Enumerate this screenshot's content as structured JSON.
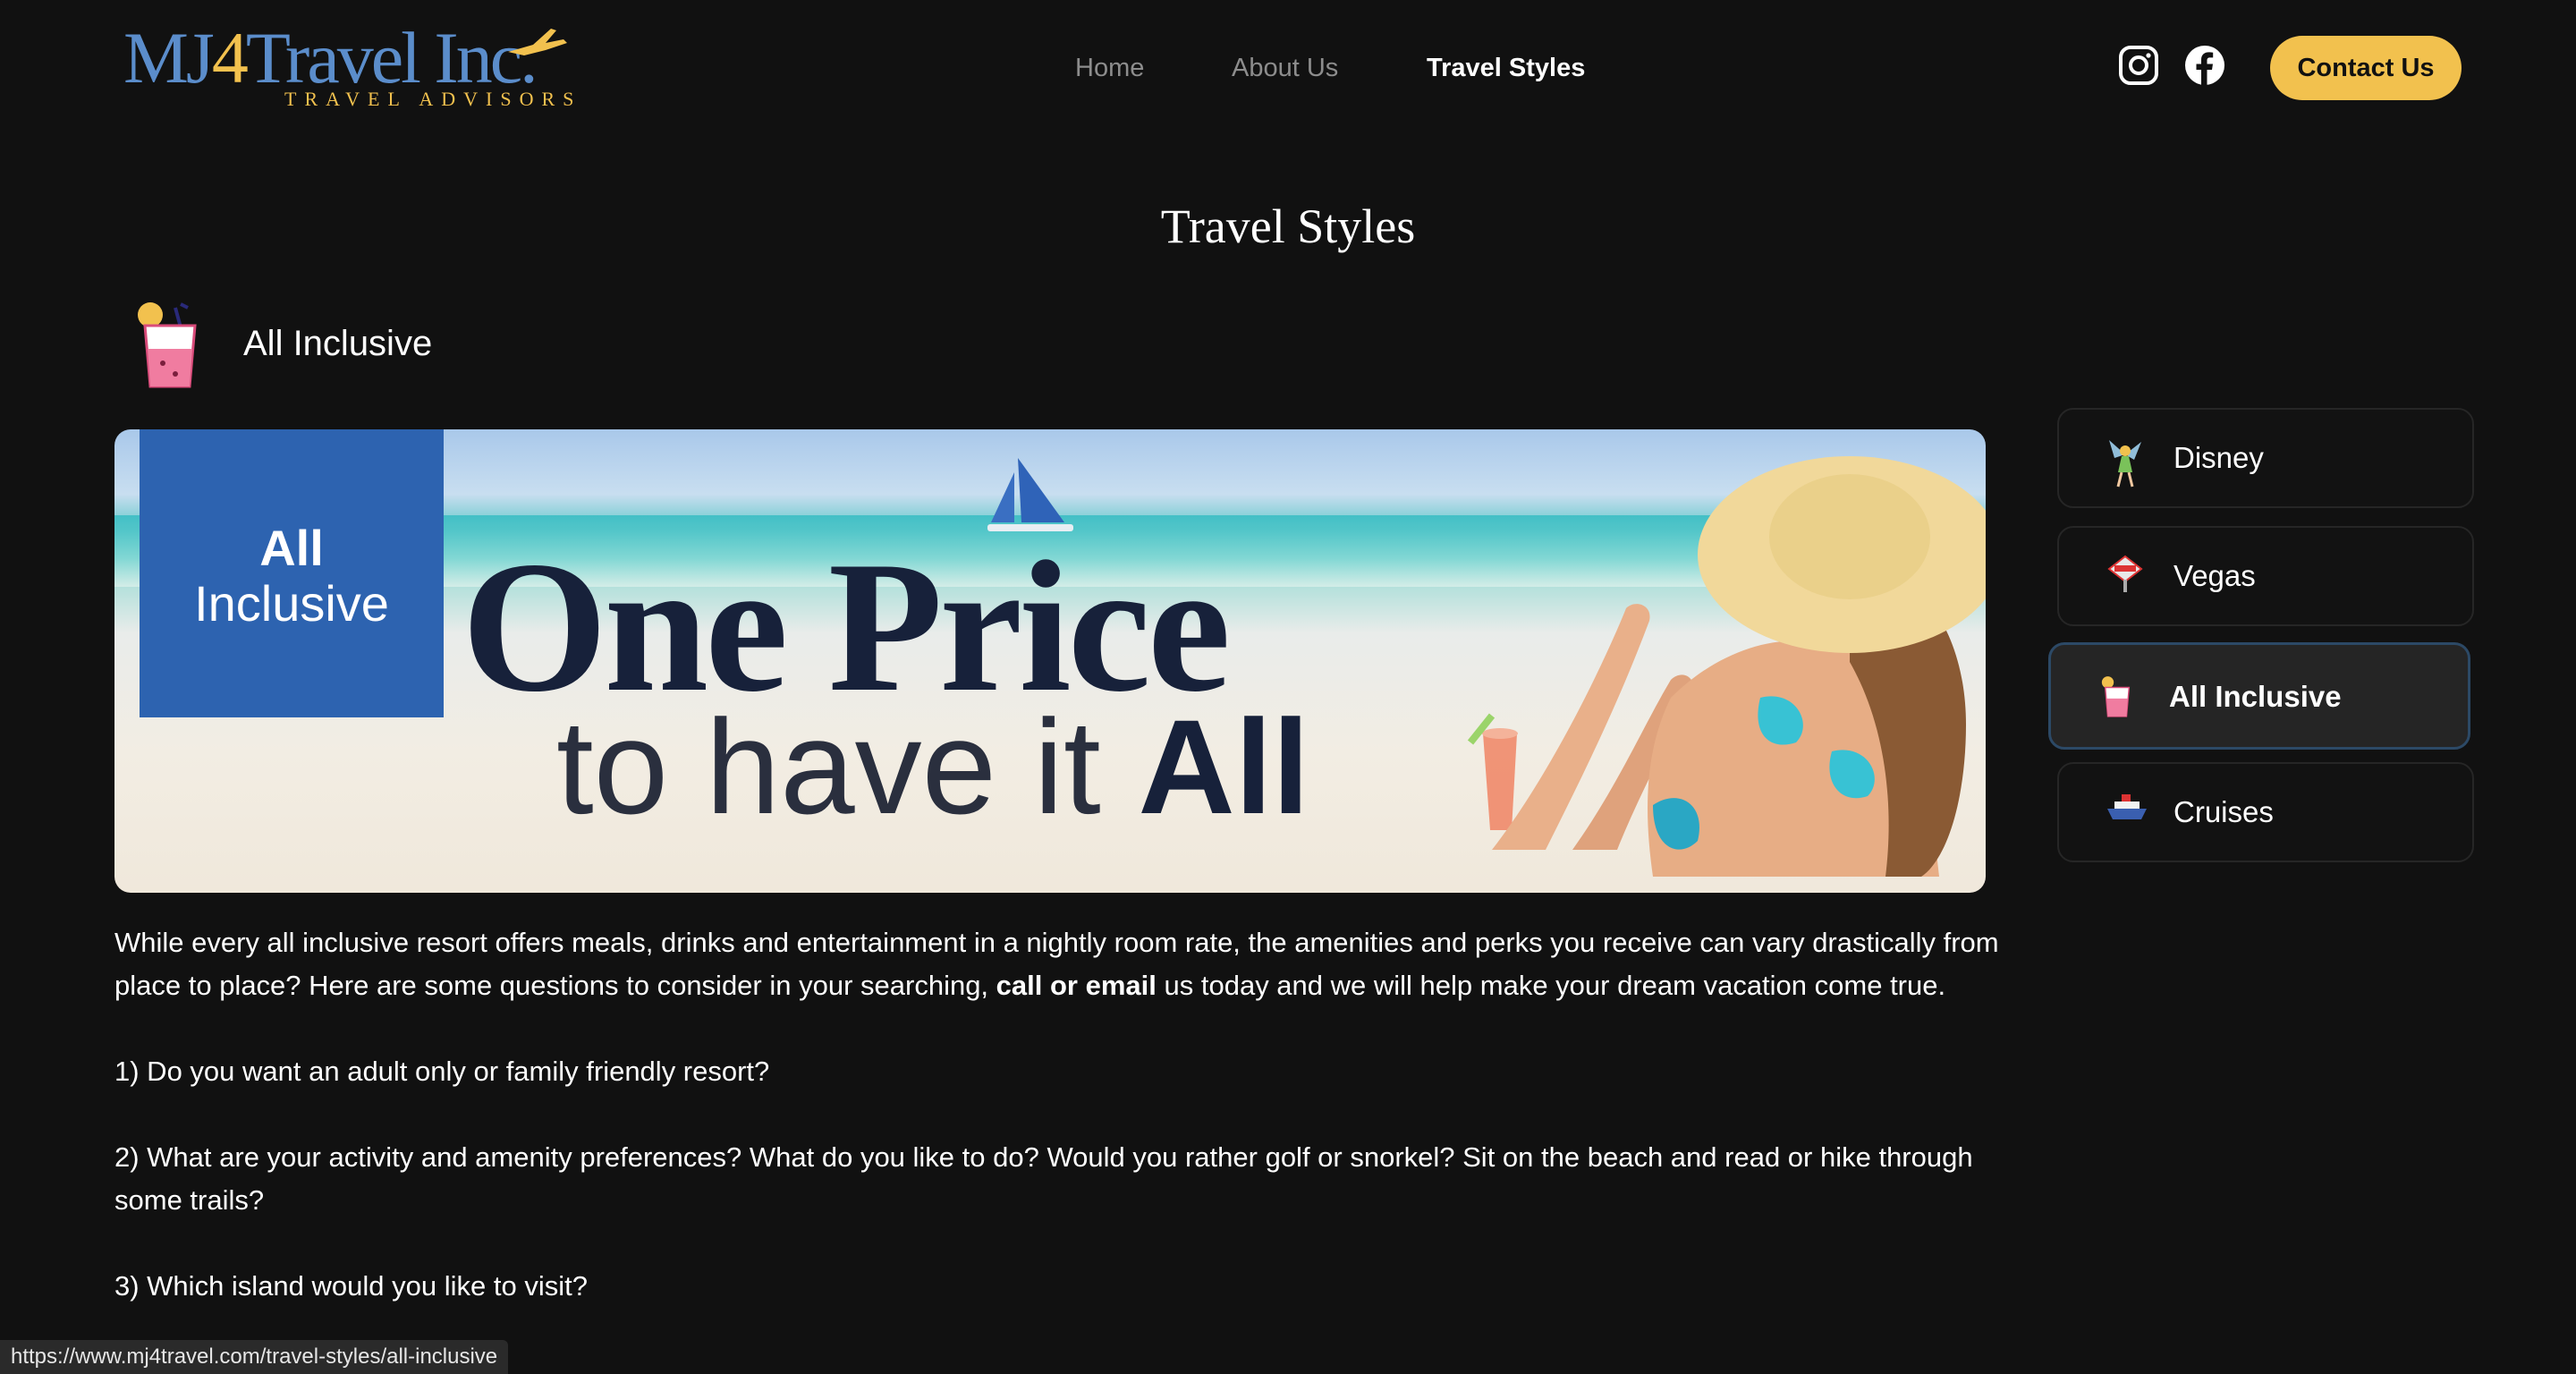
{
  "logo": {
    "main_prefix": "MJ",
    "main_four": "4",
    "main_suffix": "Travel Inc.",
    "tagline": "TRAVEL ADVISORS"
  },
  "nav": {
    "items": [
      {
        "label": "Home"
      },
      {
        "label": "About Us"
      },
      {
        "label": "Travel Styles"
      }
    ]
  },
  "header": {
    "contact_label": "Contact Us"
  },
  "page": {
    "title": "Travel Styles"
  },
  "section": {
    "label": "All Inclusive"
  },
  "banner": {
    "badge_line1": "All",
    "badge_line2": "Inclusive",
    "headline1": "One Price",
    "headline2_a": "to have it ",
    "headline2_b": "All"
  },
  "copy": {
    "intro_a": "While every all inclusive resort offers meals, drinks and entertainment in a nightly room rate, the amenities and perks you receive can vary drastically from place to place? Here are some questions to consider in your searching, ",
    "intro_bold": "call or email",
    "intro_b": " us today and we will help make your dream vacation come true.",
    "q1": "1) Do you want an adult only or family friendly resort?",
    "q2": "2) What are your activity and amenity preferences? What do you like to do? Would you rather golf or snorkel? Sit on the beach and read or hike through some trails?",
    "q3": "3) Which island would you like to visit?"
  },
  "sidebar": {
    "items": [
      {
        "label": "Disney",
        "icon": "fairy-icon"
      },
      {
        "label": "Vegas",
        "icon": "vegas-sign-icon"
      },
      {
        "label": "All Inclusive",
        "icon": "cocktail-icon"
      },
      {
        "label": "Cruises",
        "icon": "cruise-ship-icon"
      }
    ]
  },
  "status": {
    "url": "https://www.mj4travel.com/travel-styles/all-inclusive"
  },
  "colors": {
    "accent": "#f2c14e",
    "logo_blue": "#5b8dcb",
    "background": "#111111"
  }
}
